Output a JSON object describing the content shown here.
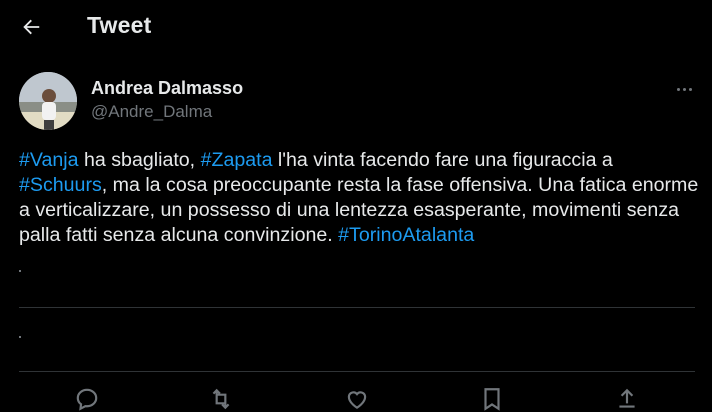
{
  "header": {
    "title": "Tweet",
    "back_icon": "arrow-left-icon"
  },
  "author": {
    "name": "Andrea Dalmasso",
    "handle": "@Andre_Dalma"
  },
  "tweet": {
    "segments": [
      {
        "text": "#Vanja",
        "hashtag": true
      },
      {
        "text": " ha sbagliato, ",
        "hashtag": false
      },
      {
        "text": "#Zapata",
        "hashtag": true
      },
      {
        "text": " l'ha vinta facendo fare una figuraccia a ",
        "hashtag": false
      },
      {
        "text": "#Schuurs",
        "hashtag": true
      },
      {
        "text": ", ma la cosa preoccupante resta la fase offensiva. Una fatica enorme a verticalizzare, un possesso di una lentezza esasperante, movimenti senza palla fatti senza alcuna convinzione. ",
        "hashtag": false
      },
      {
        "text": "#TorinoAtalanta",
        "hashtag": true
      }
    ]
  },
  "actions": [
    "reply-icon",
    "retweet-icon",
    "like-icon",
    "bookmark-icon",
    "share-icon"
  ],
  "colors": {
    "background": "#000000",
    "text": "#e7e9ea",
    "secondary": "#71767b",
    "link": "#1d9bf0",
    "divider": "#2f3336"
  }
}
